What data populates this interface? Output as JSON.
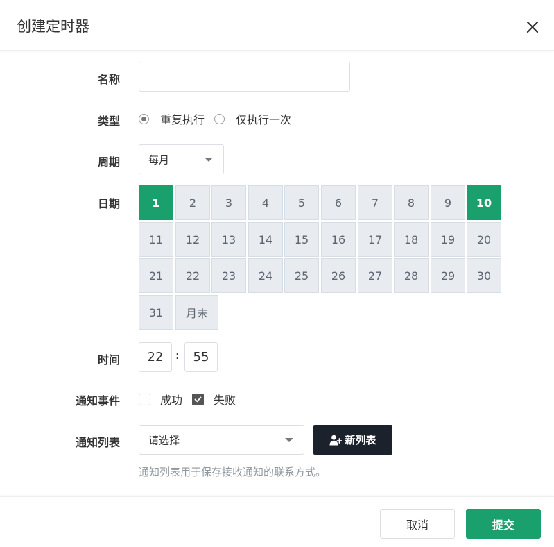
{
  "dialog": {
    "title": "创建定时器"
  },
  "form": {
    "name": {
      "label": "名称",
      "value": "",
      "placeholder": ""
    },
    "type": {
      "label": "类型",
      "options": [
        {
          "label": "重复执行",
          "checked": true
        },
        {
          "label": "仅执行一次",
          "checked": false
        }
      ]
    },
    "period": {
      "label": "周期",
      "selected": "每月"
    },
    "date": {
      "label": "日期",
      "days": [
        "1",
        "2",
        "3",
        "4",
        "5",
        "6",
        "7",
        "8",
        "9",
        "10",
        "11",
        "12",
        "13",
        "14",
        "15",
        "16",
        "17",
        "18",
        "19",
        "20",
        "21",
        "22",
        "23",
        "24",
        "25",
        "26",
        "27",
        "28",
        "29",
        "30",
        "31",
        "月末"
      ],
      "selected": [
        "1",
        "10"
      ]
    },
    "time": {
      "label": "时间",
      "hour": "22",
      "minute": "55",
      "separator": ":"
    },
    "notify_event": {
      "label": "通知事件",
      "options": [
        {
          "label": "成功",
          "checked": false
        },
        {
          "label": "失败",
          "checked": true
        }
      ]
    },
    "notify_list": {
      "label": "通知列表",
      "selected": "请选择",
      "new_button": "新列表",
      "hint": "通知列表用于保存接收通知的联系方式。"
    }
  },
  "footer": {
    "cancel": "取消",
    "submit": "提交"
  },
  "colors": {
    "primary": "#1aa06d",
    "dark_button": "#1b222b",
    "day_bg": "#e8ecf1"
  },
  "icons": {
    "close": "close-icon",
    "new_list": "user-plus-icon",
    "select_caret": "caret-down-icon"
  }
}
